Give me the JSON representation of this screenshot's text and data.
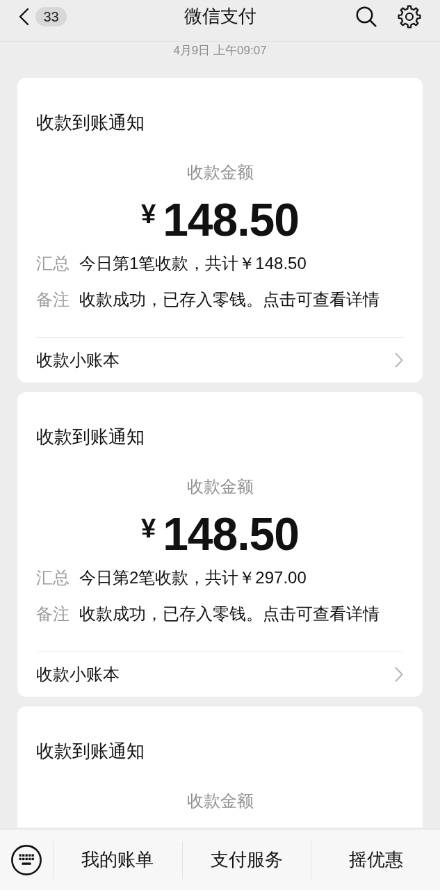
{
  "header": {
    "back_badge": "33",
    "title": "微信支付"
  },
  "timestamp": "4月9日 上午09:07",
  "messages": [
    {
      "title": "收款到账通知",
      "amount_label": "收款金额",
      "currency": "¥",
      "amount": "148.50",
      "details": [
        {
          "label": "汇总",
          "value": "今日第1笔收款，共计￥148.50"
        },
        {
          "label": "备注",
          "value": "收款成功，已存入零钱。点击可查看详情"
        }
      ],
      "link": "收款小账本"
    },
    {
      "title": "收款到账通知",
      "amount_label": "收款金额",
      "currency": "¥",
      "amount": "148.50",
      "details": [
        {
          "label": "汇总",
          "value": "今日第2笔收款，共计￥297.00"
        },
        {
          "label": "备注",
          "value": "收款成功，已存入零钱。点击可查看详情"
        }
      ],
      "link": "收款小账本"
    },
    {
      "title": "收款到账通知",
      "amount_label": "收款金额"
    }
  ],
  "bottom_menu": [
    "我的账单",
    "支付服务",
    "摇优惠"
  ]
}
